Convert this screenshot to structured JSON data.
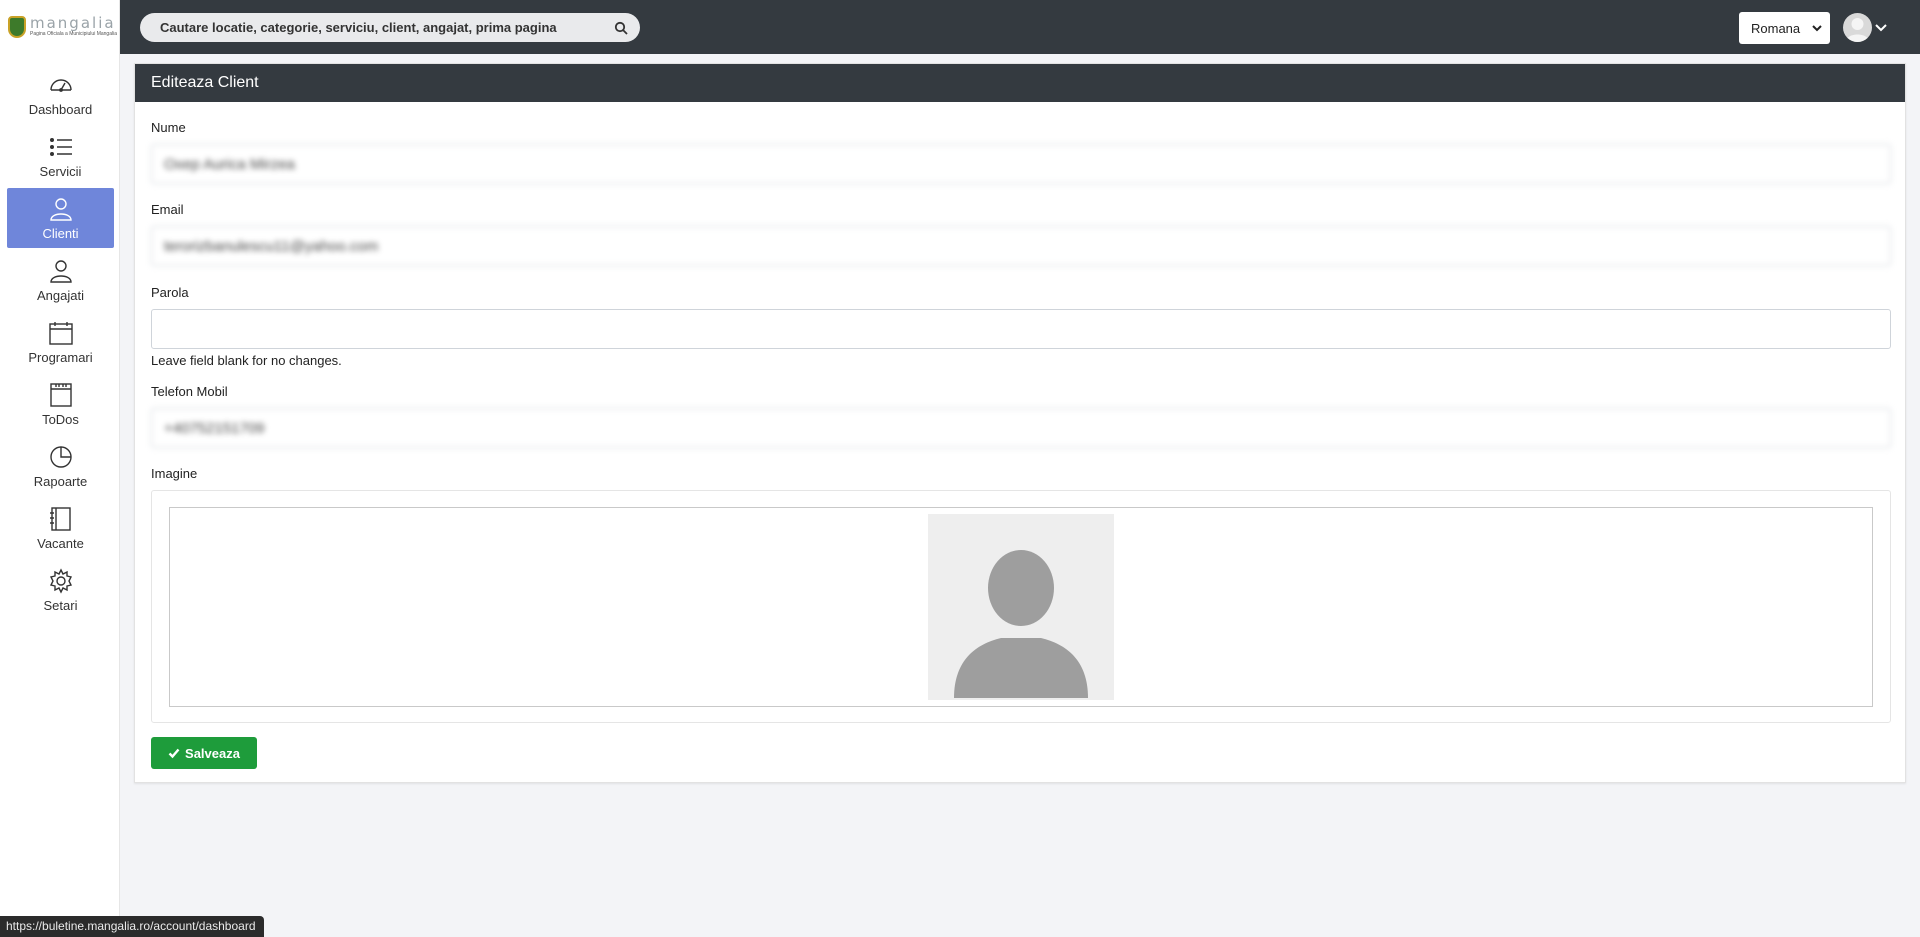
{
  "app": {
    "logo_text": "mangalia",
    "logo_subtext": "Pagina Oficiala a Municipiului Mangalia"
  },
  "sidebar": {
    "items": [
      {
        "label": "Dashboard",
        "icon": "dashboard-icon",
        "active": false
      },
      {
        "label": "Servicii",
        "icon": "list-icon",
        "active": false
      },
      {
        "label": "Clienti",
        "icon": "user-icon",
        "active": true
      },
      {
        "label": "Angajati",
        "icon": "user-icon",
        "active": false
      },
      {
        "label": "Programari",
        "icon": "calendar-icon",
        "active": false
      },
      {
        "label": "ToDos",
        "icon": "notepad-icon",
        "active": false
      },
      {
        "label": "Rapoarte",
        "icon": "pie-chart-icon",
        "active": false
      },
      {
        "label": "Vacante",
        "icon": "book-icon",
        "active": false
      },
      {
        "label": "Setari",
        "icon": "gear-icon",
        "active": false
      }
    ]
  },
  "topbar": {
    "search_placeholder": "Cautare locatie, categorie, serviciu, client, angajat, prima pagina",
    "language": "Romana"
  },
  "card": {
    "title": "Editeaza Client"
  },
  "form": {
    "name_label": "Nume",
    "name_value": "Oxep Aurica Mirzea",
    "email_label": "Email",
    "email_value": "terorizbanulescu11@yahoo.com",
    "password_label": "Parola",
    "password_value": "",
    "password_help": "Leave field blank for no changes.",
    "phone_label": "Telefon Mobil",
    "phone_value": "+40752151709",
    "image_label": "Imagine",
    "save_label": "Salveaza"
  },
  "status": {
    "url": "https://buletine.mangalia.ro/account/dashboard"
  },
  "colors": {
    "topbar": "#343a40",
    "active_nav": "#6f86da",
    "save_button": "#1e9c3b"
  }
}
